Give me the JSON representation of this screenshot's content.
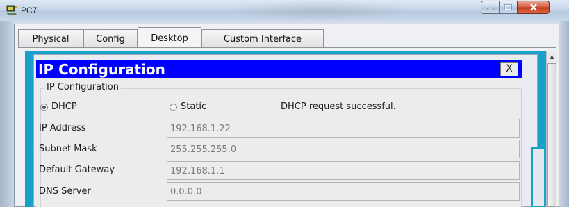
{
  "window": {
    "title": "PC7",
    "icon": "pc-icon"
  },
  "tabs": [
    {
      "label": "Physical",
      "active": false
    },
    {
      "label": "Config",
      "active": false
    },
    {
      "label": "Desktop",
      "active": true
    },
    {
      "label": "Custom Interface",
      "active": false
    }
  ],
  "dialog": {
    "title": "IP Configuration",
    "close_label": "X",
    "group_label": "IP Configuration",
    "mode": {
      "dhcp_label": "DHCP",
      "static_label": "Static",
      "selected": "DHCP",
      "status": "DHCP request successful."
    },
    "fields": [
      {
        "label": "IP Address",
        "value": "192.168.1.22"
      },
      {
        "label": "Subnet Mask",
        "value": "255.255.255.0"
      },
      {
        "label": "Default Gateway",
        "value": "192.168.1.1"
      },
      {
        "label": "DNS Server",
        "value": "0.0.0.0"
      }
    ]
  },
  "colors": {
    "dialog_titlebar": "#0000ff",
    "desktop_background": "#1aa1c9",
    "close_button": "#c2391c"
  }
}
